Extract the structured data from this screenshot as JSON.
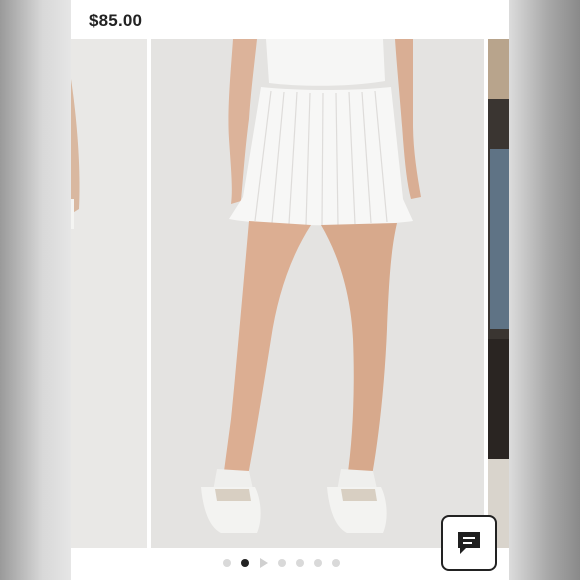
{
  "listing": {
    "price": "$85.00"
  },
  "carousel": {
    "slide_count": 7,
    "active_index": 1,
    "indicators": [
      "dot",
      "dot-active",
      "play",
      "dot",
      "dot",
      "dot",
      "dot"
    ]
  },
  "icons": {
    "chat": "chat-bubble-icon",
    "play": "play-icon"
  },
  "colors": {
    "price_text": "#222222",
    "active_dot": "#222222",
    "inactive_dot": "#d9d9d9",
    "photo_background": "#e4e3e1"
  }
}
